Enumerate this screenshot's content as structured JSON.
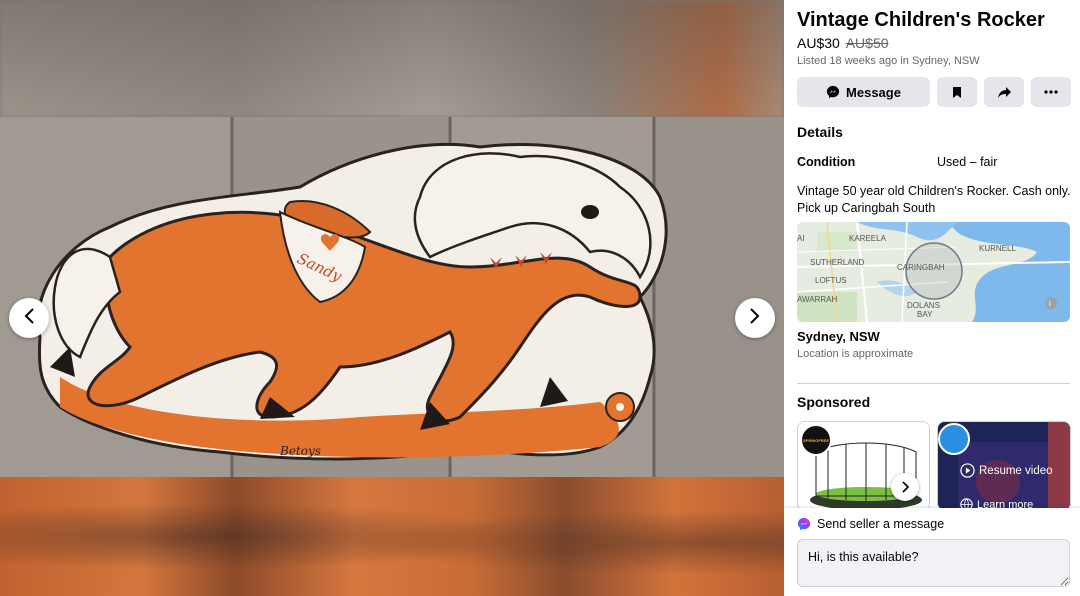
{
  "listing": {
    "title": "Vintage Children's Rocker",
    "price": "AU$30",
    "old_price": "AU$50",
    "listed_text": "Listed 18 weeks ago in Sydney, NSW"
  },
  "actions": {
    "message_label": "Message",
    "save_icon": "bookmark-icon",
    "share_icon": "share-icon",
    "more_icon": "more-icon"
  },
  "details": {
    "heading": "Details",
    "condition_label": "Condition",
    "condition_value": "Used – fair",
    "description": "Vintage 50 year old Children's Rocker. Cash only. Pick up Caringbah South"
  },
  "map": {
    "labels": [
      "KAREELA",
      "KURNELL",
      "SUTHERLAND",
      "CARINGBAH",
      "LOFTUS",
      "AWARRAH",
      "DOLANS",
      "BAY",
      "AI"
    ]
  },
  "location": {
    "name": "Sydney, NSW",
    "note": "Location is approximate"
  },
  "sponsored": {
    "heading": "Sponsored",
    "ad1_logo_text": "SPRINGFREE",
    "resume_label": "Resume video",
    "learn_label": "Learn more"
  },
  "messenger": {
    "heading": "Send seller a message",
    "input_value": "Hi, is this available?"
  },
  "photo": {
    "signature_text": "Sandy",
    "maker_text": "Betoys"
  },
  "colors": {
    "accent": "#1877f2",
    "button_bg": "#e4e6eb",
    "rocker_orange": "#e2742f",
    "messenger_gradient": [
      "#0099ff",
      "#a033ff",
      "#ff5280"
    ]
  }
}
